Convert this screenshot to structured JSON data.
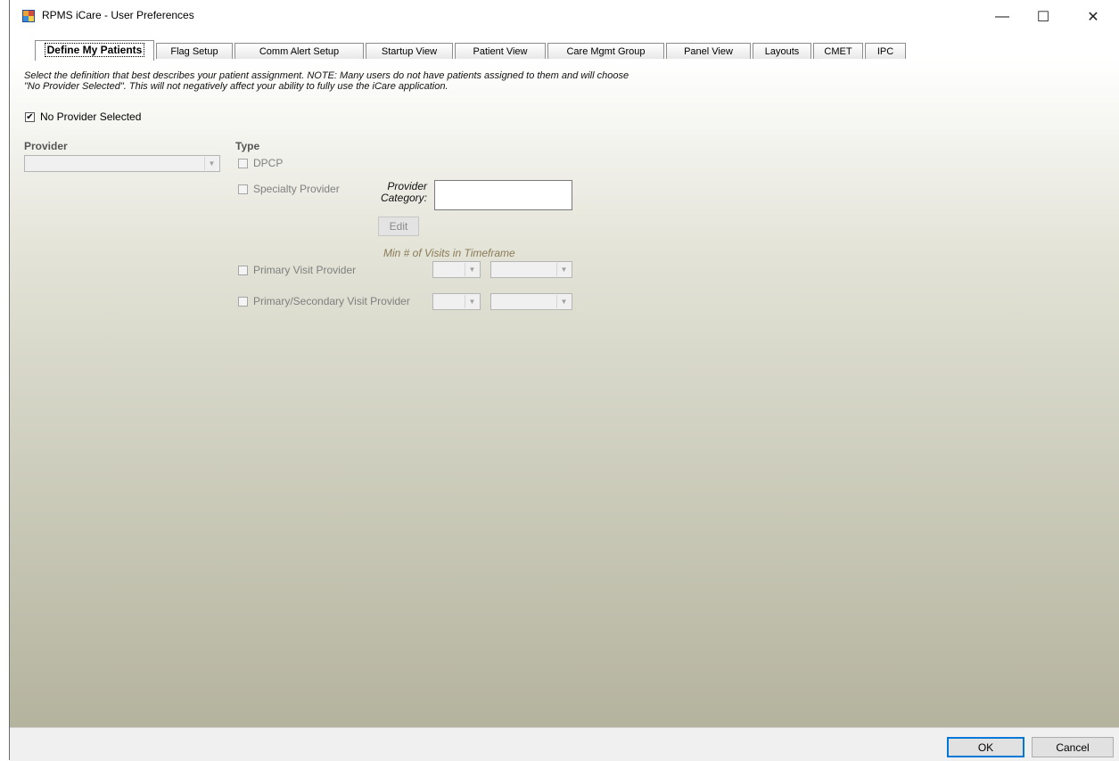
{
  "window": {
    "title": "RPMS iCare - User Preferences",
    "controls": {
      "minimize": "—",
      "maximize": "☐",
      "close": "✕"
    }
  },
  "tabs": [
    {
      "label": "Define My Patients",
      "active": true
    },
    {
      "label": "Flag Setup"
    },
    {
      "label": "Comm Alert Setup"
    },
    {
      "label": "Startup View"
    },
    {
      "label": "Patient View"
    },
    {
      "label": "Care Mgmt Group"
    },
    {
      "label": "Panel View"
    },
    {
      "label": "Layouts"
    },
    {
      "label": "CMET"
    },
    {
      "label": "IPC"
    }
  ],
  "instructions": {
    "line1": "Select the definition that best describes your patient assignment. NOTE:  Many users do not have patients assigned to them and will choose",
    "line2": "\"No Provider Selected\".  This will not negatively affect your ability to fully use the iCare application."
  },
  "no_provider": {
    "label": "No Provider Selected",
    "checked": true,
    "mark": "✔"
  },
  "provider": {
    "header": "Provider",
    "value": ""
  },
  "type": {
    "header": "Type",
    "dpcp": "DPCP",
    "specialty": "Specialty Provider",
    "category_label": "Provider Category:",
    "category_value": "",
    "edit_label": "Edit",
    "min_visits_label": "Min # of Visits in Timeframe",
    "primary_visit": "Primary Visit Provider",
    "primary_secondary": "Primary/Secondary Visit Provider"
  },
  "arrow_glyph": "▼",
  "footer": {
    "ok_label": "OK",
    "cancel_label": "Cancel"
  },
  "colors": {
    "accent": "#0078d7",
    "gradient_bottom": "#b4b39e"
  }
}
